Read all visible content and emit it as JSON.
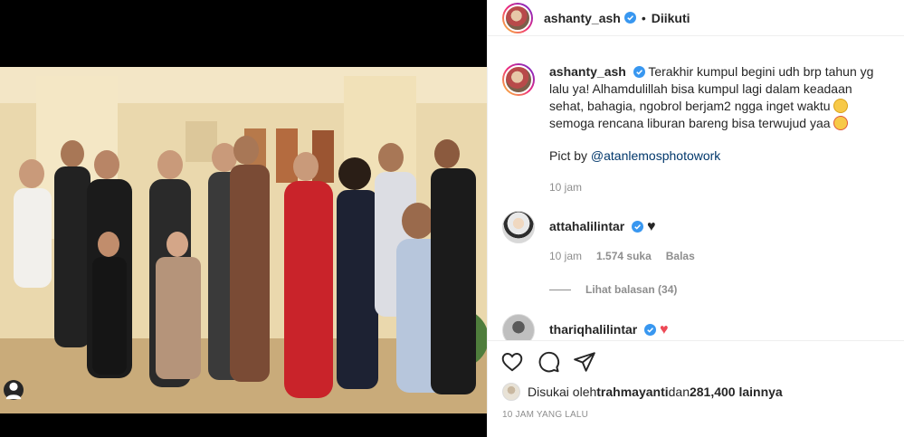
{
  "header": {
    "username": "ashanty_ash",
    "separator": "•",
    "follow_status": "Diikuti"
  },
  "caption": {
    "username": "ashanty_ash",
    "text_1": " Terakhir kumpul begini udh brp tahun yg lalu ya! Alhamdulillah bisa kumpul lagi dalam keadaan sehat, bahagia, ngobrol berjam2 ngga inget waktu",
    "text_2": " semoga rencana liburan bareng bisa terwujud yaa",
    "credit_prefix": "Pict by ",
    "credit_mention": "@atanlemosphotowork",
    "time": "10 jam",
    "emoji_1": "grin-sweat-emoji",
    "emoji_2": "star-struck-emoji"
  },
  "comments": [
    {
      "username": "attahalilintar",
      "heart": "♥",
      "heart_color": "#262626",
      "time": "10 jam",
      "likes": "1.574 suka",
      "reply": "Balas",
      "replies_label": "Lihat balasan (34)"
    },
    {
      "username": "thariqhalilintar",
      "heart": "♥",
      "heart_color": "#ed4956"
    }
  ],
  "likes": {
    "prefix": "Disukai oleh ",
    "user": "trahmayanti",
    "middle": " dan ",
    "count": "281,400 lainnya"
  },
  "timestamp": "10 JAM YANG LALU",
  "colors": {
    "verified": "#3897f0",
    "mention": "#00376b",
    "muted": "#8e8e8e",
    "text": "#262626"
  },
  "icons": [
    "heart-outline-icon",
    "comment-icon",
    "share-icon",
    "verified-icon",
    "user-tag-icon"
  ]
}
